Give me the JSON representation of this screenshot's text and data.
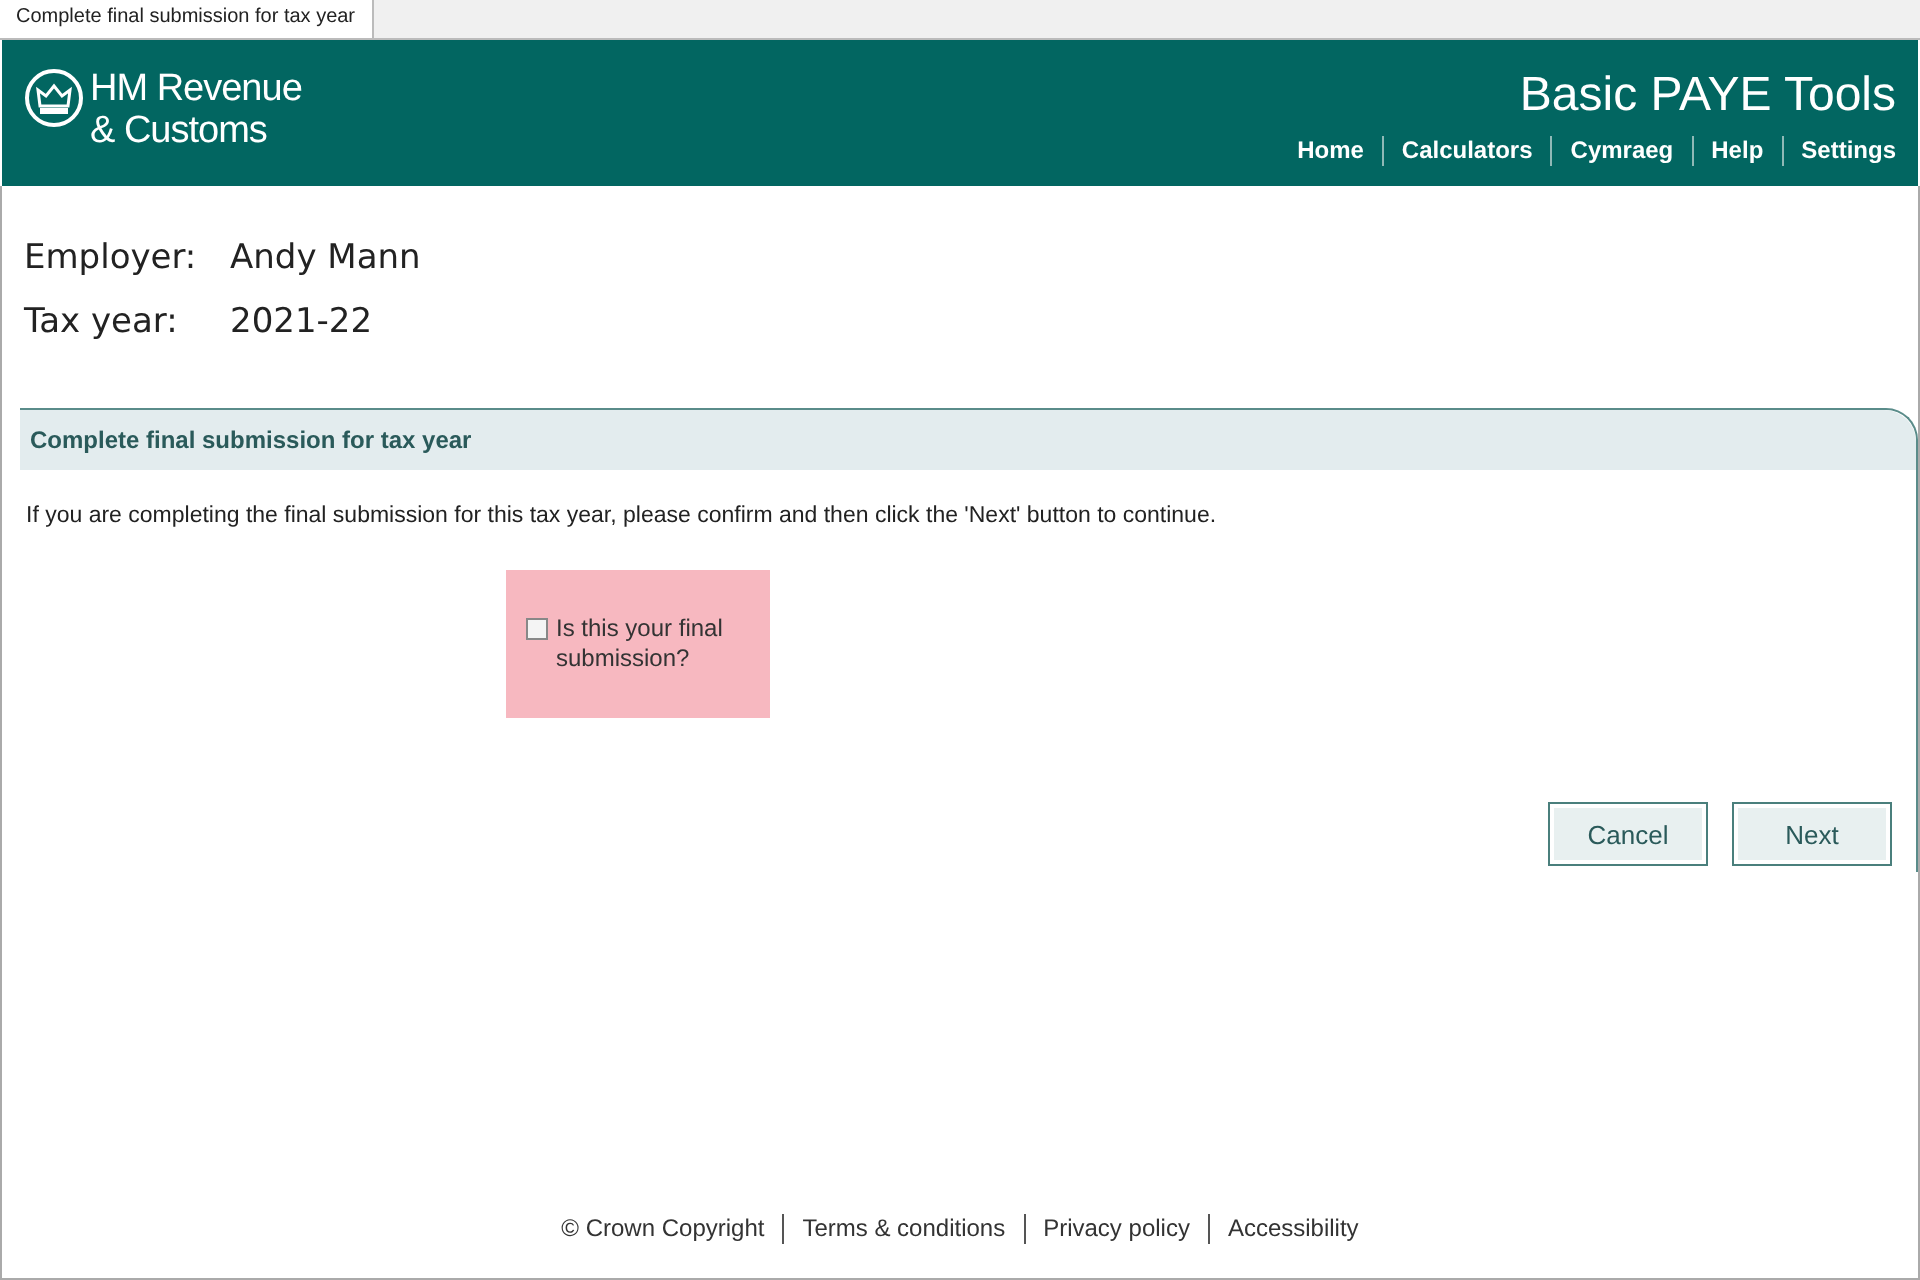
{
  "tab": {
    "label": "Complete final submission for tax year",
    "selected": true
  },
  "header": {
    "logo_line_1": "HM Revenue",
    "logo_line_2": "& Customs",
    "app_title": "Basic PAYE Tools",
    "nav": [
      "Home",
      "Calculators",
      "Cymraeg",
      "Help",
      "Settings"
    ]
  },
  "employer": [
    {
      "label": "Employer:",
      "value": "Andy Mann"
    },
    {
      "label": "Tax year:",
      "value": "2021-22"
    }
  ],
  "panel": {
    "title": "Complete final submission for tax year",
    "instruction": "If you are completing the final submission for this tax year, please confirm and then click the 'Next' button to continue.",
    "confirm": {
      "label": "Is this your final submission?",
      "checked": false
    },
    "buttons": [
      "Cancel",
      "Next"
    ]
  },
  "footer": [
    "© Crown Copyright",
    "Terms & conditions",
    "Privacy policy",
    "Accessibility"
  ]
}
